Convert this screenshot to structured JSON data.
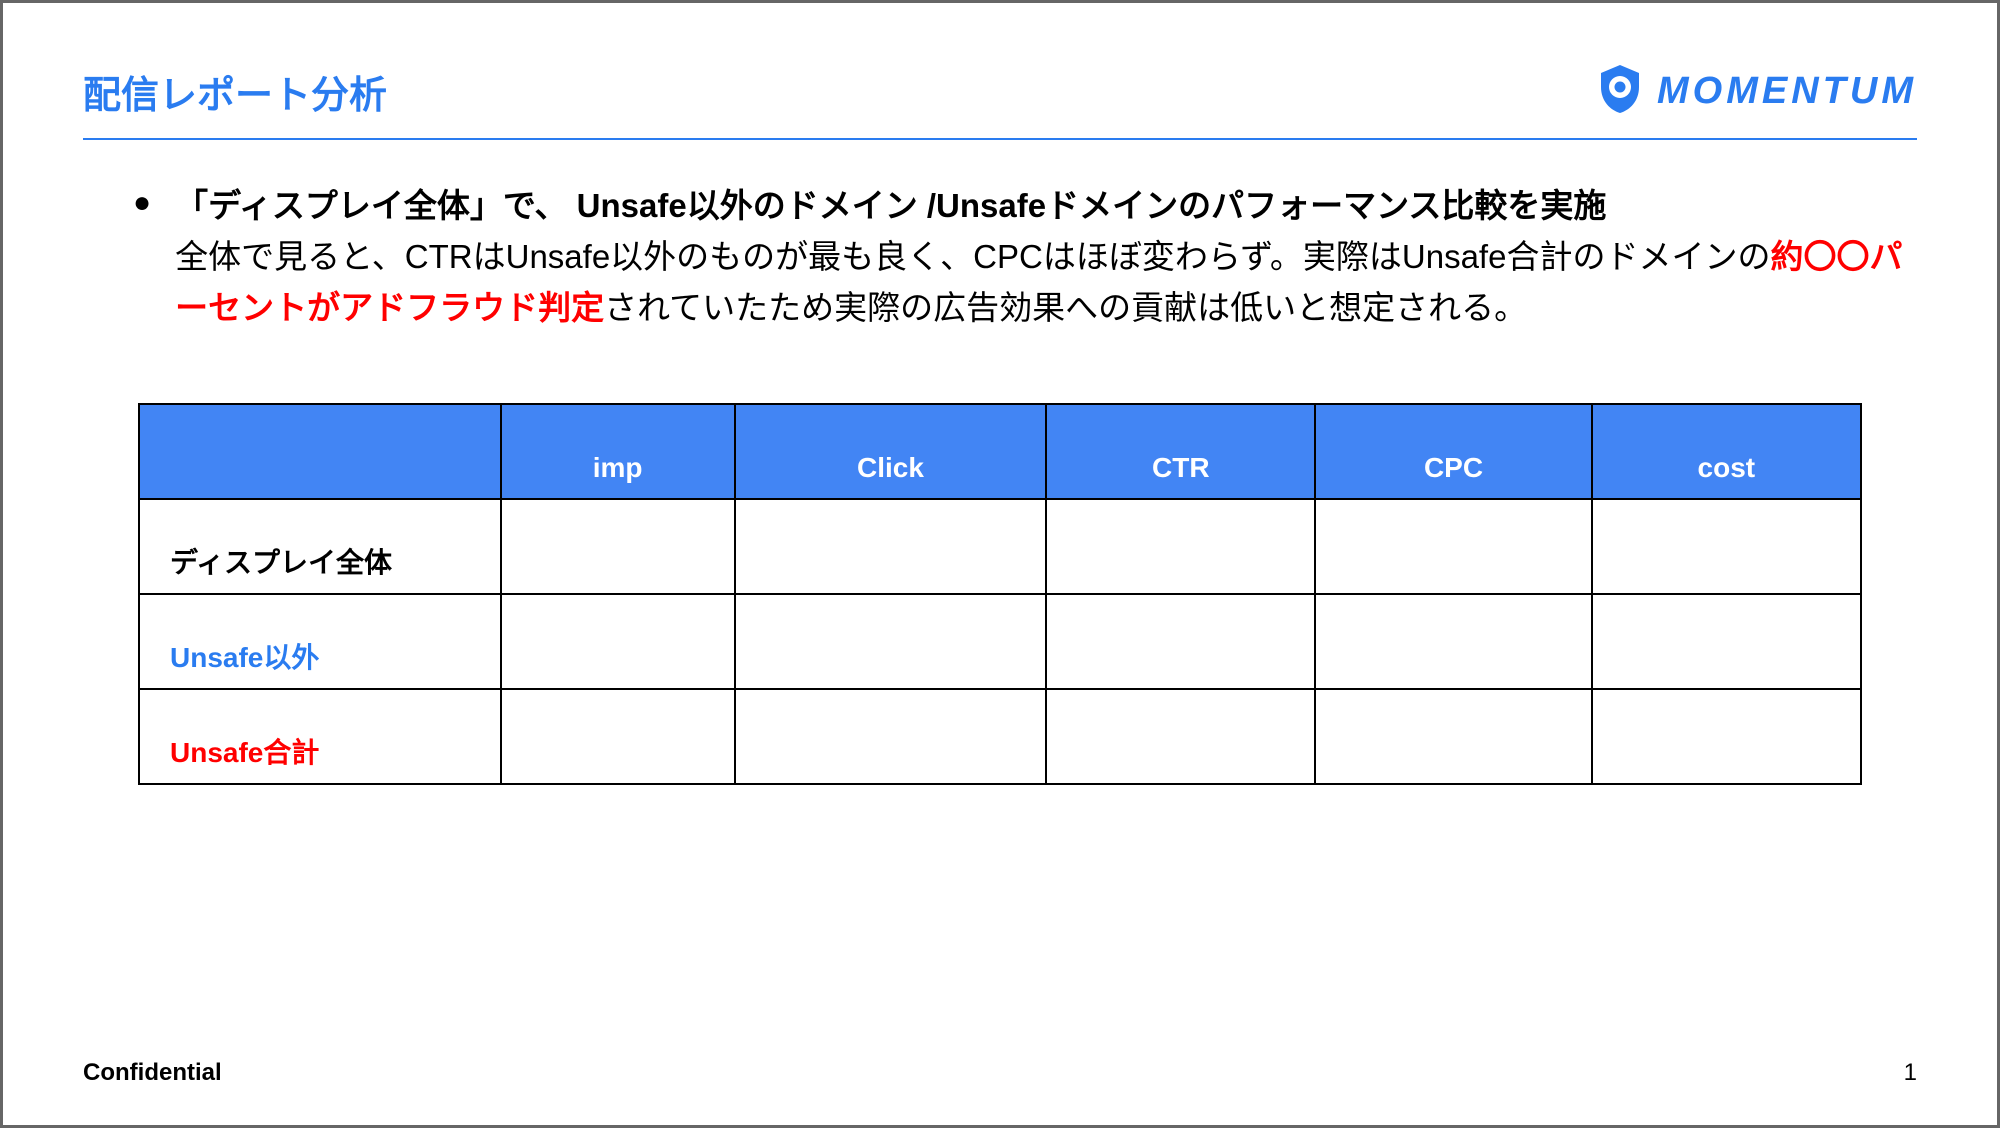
{
  "header": {
    "title": "配信レポート分析",
    "brand": "MOMENTUM"
  },
  "bullet": {
    "line1_bold": "「ディスプレイ全体」で、 Unsafe以外のドメイン /Unsafeドメインのパフォーマンス比較を実施",
    "line2_a": "全体で見ると、CTRはUnsafe以外のものが最も良く、CPCはほぼ変わらず。実際はUnsafe合計のドメインの",
    "line2_red": "約〇〇パーセントがアドフラウド判定",
    "line2_b": "されていたため実際の広告効果への貢献は低いと想定される。"
  },
  "table": {
    "columns": [
      "imp",
      "Click",
      "CTR",
      "CPC",
      "cost"
    ],
    "rows": [
      {
        "label": "ディスプレイ全体",
        "style": "black",
        "values": [
          "",
          "",
          "",
          "",
          ""
        ]
      },
      {
        "label": "Unsafe以外",
        "style": "blue",
        "values": [
          "",
          "",
          "",
          "",
          ""
        ]
      },
      {
        "label": "Unsafe合計",
        "style": "red",
        "values": [
          "",
          "",
          "",
          "",
          ""
        ]
      }
    ]
  },
  "footer": {
    "confidential": "Confidential",
    "page": "1"
  },
  "colors": {
    "accent_blue": "#2a7cf0",
    "header_blue": "#4285f4",
    "red": "#ff0000"
  }
}
